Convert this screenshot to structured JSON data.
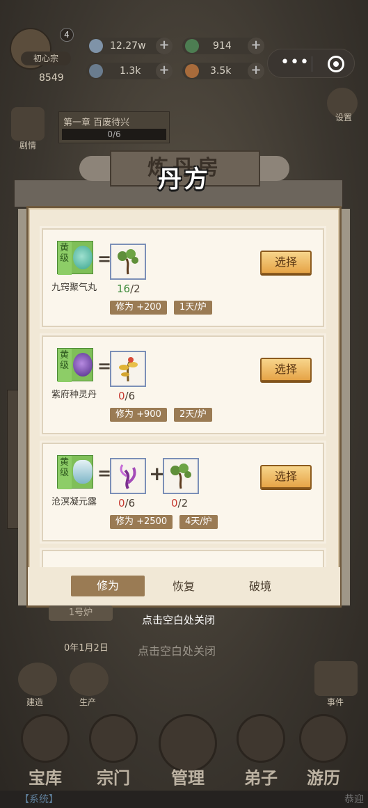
{
  "player": {
    "level": "4",
    "sect_name": "初心宗",
    "combat_power": "8549"
  },
  "resources": {
    "spirit_stone": "12.27w",
    "jade": "914",
    "essence": "1.3k",
    "pill": "3.5k"
  },
  "mini_program_capsule": {
    "more": "•••"
  },
  "chapter": {
    "title": "第一章 百废待兴",
    "progress": "0/6"
  },
  "side_labels": {
    "story": "剧情",
    "settings": "设置",
    "build": "建造",
    "produce": "生产",
    "event": "事件"
  },
  "background_notice": {
    "date": "0年1月2日",
    "close_hint": "点击空白处关闭"
  },
  "building_banner": "炼丹房",
  "panel": {
    "title": "丹方",
    "select_label": "选择",
    "recipes": [
      {
        "grade": "黄级",
        "name": "九窍聚气丸",
        "ingredients": [
          {
            "have": "16",
            "need": "/2",
            "ok": true
          }
        ],
        "effect": "修为 +200",
        "time": "1天/炉",
        "pill_color": "#4fb3a0"
      },
      {
        "grade": "黄级",
        "name": "紫府种灵丹",
        "ingredients": [
          {
            "have": "0",
            "need": "/6",
            "ok": false
          }
        ],
        "effect": "修为 +900",
        "time": "2天/炉",
        "pill_color": "#6a3fa0"
      },
      {
        "grade": "黄级",
        "name": "沧溟凝元露",
        "ingredients": [
          {
            "have": "0",
            "need": "/6",
            "ok": false
          },
          {
            "have": "0",
            "need": "/2",
            "ok": false
          }
        ],
        "effect": "修为 +2500",
        "time": "4天/炉",
        "pill_color": "#9bc7d8"
      }
    ],
    "tabs": [
      "修为",
      "恢复",
      "破境"
    ],
    "furnace": "1号炉",
    "close_hint": "点击空白处关闭"
  },
  "bottom_nav": [
    "宝库",
    "宗门",
    "管理",
    "弟子",
    "游历"
  ],
  "system_bar": {
    "channel": "【系统】",
    "message": "恭迎"
  },
  "colors": {
    "grade_green": "#7fbf58",
    "enough": "#3d8a3a",
    "lacking": "#c63b32",
    "tag": "#9a7b54",
    "button": "#e6a447"
  }
}
